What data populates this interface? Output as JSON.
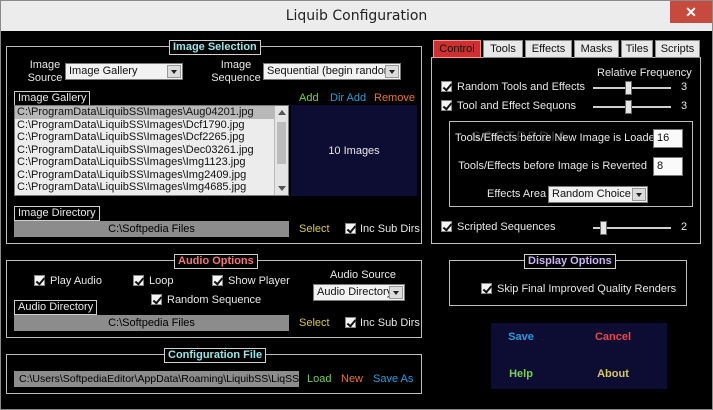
{
  "window": {
    "title": "Liquib Configuration",
    "close": "✕"
  },
  "image_selection": {
    "legend": "Image Selection",
    "source_label": "Image Source",
    "source_value": "Image Gallery",
    "sequence_label": "Image Sequence",
    "sequence_value": "Sequential (begin random)",
    "gallery_label": "Image Gallery",
    "add": "Add",
    "dir_add": "Dir Add",
    "remove": "Remove",
    "gallery_items": [
      "C:\\ProgramData\\LiquibSS\\Images\\Aug04201.jpg",
      "C:\\ProgramData\\LiquibSS\\Images\\Dcf1790.jpg",
      "C:\\ProgramData\\LiquibSS\\Images\\Dcf2265.jpg",
      "C:\\ProgramData\\LiquibSS\\Images\\Dec03261.jpg",
      "C:\\ProgramData\\LiquibSS\\Images\\Img1123.jpg",
      "C:\\ProgramData\\LiquibSS\\Images\\Img2409.jpg",
      "C:\\ProgramData\\LiquibSS\\Images\\Img4685.jpg"
    ],
    "image_count": "10 Images",
    "directory_label": "Image Directory",
    "directory_value": "C:\\Softpedia Files",
    "select": "Select",
    "inc_sub_dirs": "Inc Sub Dirs"
  },
  "audio_options": {
    "legend": "Audio Options",
    "play_audio": "Play Audio",
    "loop": "Loop",
    "show_player": "Show Player",
    "random_sequence": "Random Sequence",
    "source_label": "Audio Source",
    "source_value": "Audio Directory",
    "directory_label": "Audio Directory",
    "directory_value": "C:\\Softpedia Files",
    "select": "Select",
    "inc_sub_dirs": "Inc Sub Dirs"
  },
  "configuration_file": {
    "legend": "Configuration File",
    "path": "C:\\Users\\SoftpediaEditor\\AppData\\Roaming\\LiquibSS\\LiqSS.liq",
    "load": "Load",
    "new": "New",
    "save_as": "Save As"
  },
  "tabs": [
    "Control",
    "Tools",
    "Effects",
    "Masks",
    "Tiles",
    "Scripts"
  ],
  "control": {
    "relative_frequency": "Relative Frequency",
    "random_tools": "Random Tools and Effects",
    "random_tools_value": "3",
    "random_tools_level": 0.45,
    "tool_sequons": "Tool and Effect Sequons",
    "tool_sequons_value": "3",
    "tool_sequons_level": 0.45,
    "before_loaded_label": "Tools/Effects before New Image is Loaded",
    "before_loaded_value": "16",
    "before_reverted_label": "Tools/Effects before Image is Reverted",
    "before_reverted_value": "8",
    "effects_area_label": "Effects Area",
    "effects_area_value": "Random Choice",
    "scripted_sequences": "Scripted Sequences",
    "scripted_sequences_value": "2",
    "scripted_sequences_level": 0.1
  },
  "display_options": {
    "legend": "Display Options",
    "skip_final": "Skip Final Improved Quality Renders"
  },
  "buttons": {
    "save": "Save",
    "cancel": "Cancel",
    "help": "Help",
    "about": "About"
  },
  "watermark": "SOFTPEDIA",
  "colors": {
    "active_tab": "#cc3030",
    "green": "#79cf52",
    "orange": "#e67438",
    "cyan": "#2f9ad8"
  }
}
